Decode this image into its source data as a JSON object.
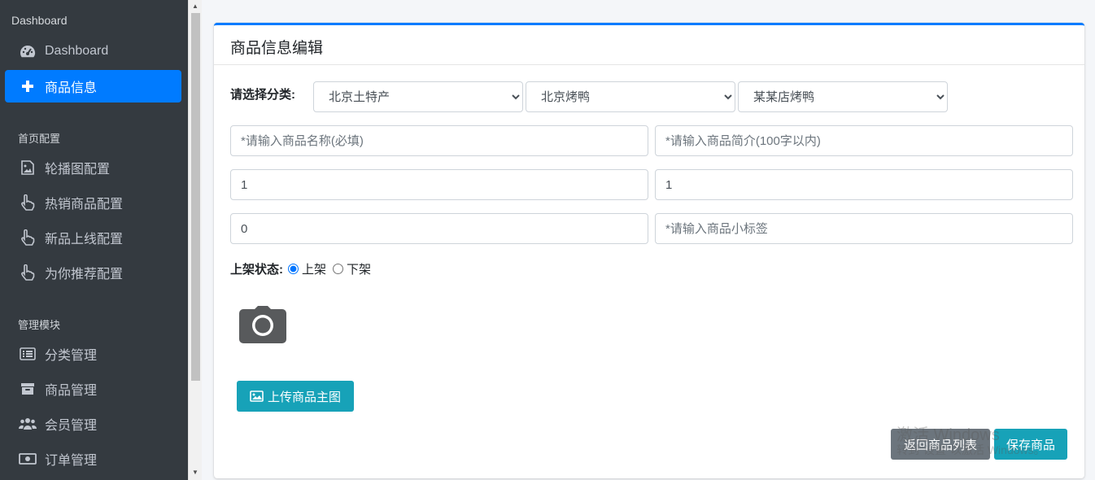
{
  "sidebar": {
    "header": "Dashboard",
    "items_top": [
      {
        "label": "Dashboard",
        "icon": "tachometer-icon"
      },
      {
        "label": "商品信息",
        "icon": "plus-icon"
      }
    ],
    "section1": "首页配置",
    "items_home": [
      {
        "label": "轮播图配置",
        "icon": "image-icon"
      },
      {
        "label": "热销商品配置",
        "icon": "hand-pointer-icon"
      },
      {
        "label": "新品上线配置",
        "icon": "hand-pointer-icon"
      },
      {
        "label": "为你推荐配置",
        "icon": "hand-pointer-icon"
      }
    ],
    "section2": "管理模块",
    "items_manage": [
      {
        "label": "分类管理",
        "icon": "list-icon"
      },
      {
        "label": "商品管理",
        "icon": "archive-icon"
      },
      {
        "label": "会员管理",
        "icon": "users-icon"
      },
      {
        "label": "订单管理",
        "icon": "money-icon"
      }
    ],
    "active_color": "#007bff"
  },
  "card": {
    "title": "商品信息编辑",
    "category_label": "请选择分类:",
    "category_selects": [
      "北京土特产",
      "北京烤鸭",
      "某某店烤鸭"
    ],
    "fields": {
      "name_placeholder": "*请输入商品名称(必填)",
      "intro_placeholder": "*请输入商品简介(100字以内)",
      "field3_value": "1",
      "field4_value": "1",
      "field5_value": "0",
      "tag_placeholder": "*请输入商品小标签"
    },
    "status_label": "上架状态:",
    "status_options": [
      "上架",
      "下架"
    ],
    "status_selected": "上架",
    "upload_button": "上传商品主图",
    "back_button": "返回商品列表",
    "save_button": "保存商品"
  },
  "watermark": {
    "line1": "激活 Windows",
    "line2": "转到\"设置\"以激活 Windows。"
  },
  "colors": {
    "sidebar_bg": "#343a40",
    "primary": "#007bff",
    "info": "#17a2b8",
    "secondary": "#6c757d"
  }
}
